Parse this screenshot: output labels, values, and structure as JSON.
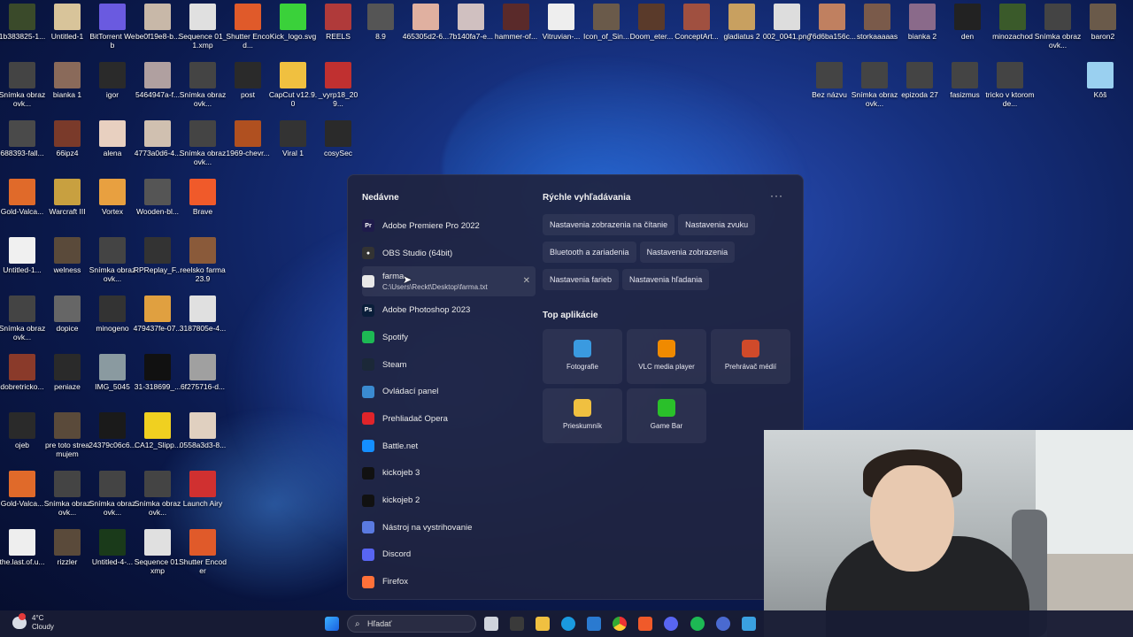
{
  "desktop": {
    "icons": [
      {
        "label": "1b383825-1...",
        "c": "#3a4a2a"
      },
      {
        "label": "Untitled-1",
        "c": "#d8c49a"
      },
      {
        "label": "BitTorrent Web",
        "c": "#6a5ae0"
      },
      {
        "label": "be0f19e8-b...",
        "c": "#c8b8a8"
      },
      {
        "label": "Sequence 01_1.xmp",
        "c": "#e0e0e0"
      },
      {
        "label": "Shutter Encod...",
        "c": "#e05a2a"
      },
      {
        "label": "Kick_logo.svg",
        "c": "#3ad13a"
      },
      {
        "label": "REELS",
        "c": "#b03a3a"
      },
      {
        "label": "Snímka obrazovk...",
        "c": "#444"
      },
      {
        "label": "bianka 1",
        "c": "#8a6a5a"
      },
      {
        "label": "igor",
        "c": "#2a2a2a"
      },
      {
        "label": "5464947a-f...",
        "c": "#b0a0a0"
      },
      {
        "label": "Snímka obrazovk...",
        "c": "#444"
      },
      {
        "label": "post",
        "c": "#2a2a2a"
      },
      {
        "label": "CapCut v12.9.0",
        "c": "#f0c040"
      },
      {
        "label": "_vyrp18_209...",
        "c": "#c03030"
      },
      {
        "label": "688393-fall...",
        "c": "#4a4a4a"
      },
      {
        "label": "66ipz4",
        "c": "#7a3a2a"
      },
      {
        "label": "alena",
        "c": "#e8d0c0"
      },
      {
        "label": "4773a0d6-4...",
        "c": "#d0c0b0"
      },
      {
        "label": "Snímka obrazovk...",
        "c": "#444"
      },
      {
        "label": "1969-chevr...",
        "c": "#b05020"
      },
      {
        "label": "Viral 1",
        "c": "#333"
      },
      {
        "label": "cosySec",
        "c": "#2a2a2a"
      },
      {
        "label": "Gold-Valca...",
        "c": "#e06a2a"
      },
      {
        "label": "Warcraft III",
        "c": "#c8a040"
      },
      {
        "label": "Vortex",
        "c": "#e8a040"
      },
      {
        "label": "Wooden-bl...",
        "c": "#555"
      },
      {
        "label": "Brave",
        "c": "#f05a2a"
      },
      {
        "label": "Untitled-1...",
        "c": "#f0f0f0"
      },
      {
        "label": "welness",
        "c": "#5a4a3a"
      },
      {
        "label": "Snímka obrazovk...",
        "c": "#444"
      },
      {
        "label": "RPReplay_F...",
        "c": "#333"
      },
      {
        "label": "reelsko farma 23.9",
        "c": "#8a5a3a"
      },
      {
        "label": "Snímka obrazovk...",
        "c": "#444"
      },
      {
        "label": "dopice",
        "c": "#666"
      },
      {
        "label": "minogeno",
        "c": "#333"
      },
      {
        "label": "479437fe-07...",
        "c": "#e0a040"
      },
      {
        "label": "3187805e-4...",
        "c": "#e0e0e0"
      },
      {
        "label": "dobretricko...",
        "c": "#8a3a2a"
      },
      {
        "label": "peniaze",
        "c": "#2a2a2a"
      },
      {
        "label": "IMG_5045",
        "c": "#8a9aa0"
      },
      {
        "label": "31-318699_...",
        "c": "#111"
      },
      {
        "label": "6f275716-d...",
        "c": "#a0a0a0"
      },
      {
        "label": "ojeb",
        "c": "#2a2a2a"
      },
      {
        "label": "pre toto streamujem",
        "c": "#5a4a3a"
      },
      {
        "label": "24379c06c6...",
        "c": "#1a1a1a"
      },
      {
        "label": "CA12_Slipp...",
        "c": "#f0d020"
      },
      {
        "label": "0558a3d3-8...",
        "c": "#e0d0c0"
      },
      {
        "label": "Gold-Valca...",
        "c": "#e06a2a"
      },
      {
        "label": "Snímka obrazovk...",
        "c": "#444"
      },
      {
        "label": "Snímka obrazovk...",
        "c": "#444"
      },
      {
        "label": "Snímka obrazovk...",
        "c": "#444"
      },
      {
        "label": "Launch Airy",
        "c": "#d03030"
      },
      {
        "label": "the.last.of.u...",
        "c": "#eee"
      },
      {
        "label": "rizzler",
        "c": "#5a4a3a"
      },
      {
        "label": "Untitled-4-...",
        "c": "#1a3a1a"
      },
      {
        "label": "Sequence 01.xmp",
        "c": "#e0e0e0"
      },
      {
        "label": "Shutter Encoder",
        "c": "#e05a2a"
      }
    ],
    "icons2": [
      {
        "label": "8.9",
        "c": "#555"
      },
      {
        "label": "465305d2-6...",
        "c": "#e0b0a0"
      },
      {
        "label": "7b140fa7-e...",
        "c": "#d0c0c0"
      },
      {
        "label": "hammer-of...",
        "c": "#5a2a2a"
      },
      {
        "label": "Vitruvian-...",
        "c": "#eee"
      },
      {
        "label": "Icon_of_Sin...",
        "c": "#6a5a4a"
      },
      {
        "label": "Doom_eter...",
        "c": "#5a3a2a"
      },
      {
        "label": "ConceptArt...",
        "c": "#a05040"
      },
      {
        "label": "gladiatus 2",
        "c": "#c8a060"
      },
      {
        "label": "002_0041.png",
        "c": "#ddd"
      },
      {
        "label": "76d6ba156c...",
        "c": "#c08060"
      },
      {
        "label": "storkaaaaas",
        "c": "#7a5a4a"
      },
      {
        "label": "bianka 2",
        "c": "#8a6a8a"
      },
      {
        "label": "den",
        "c": "#222"
      },
      {
        "label": "minozachod",
        "c": "#3a5a2a"
      },
      {
        "label": "Snímka obrazovk...",
        "c": "#444"
      },
      {
        "label": "baron2",
        "c": "#6a5a4a"
      }
    ],
    "right_labels": [
      "Bez názvu",
      "Snímka obrazovk...",
      "epizoda 27",
      "fasizmus",
      "tricko v ktorom de...",
      "Kôš"
    ]
  },
  "start_menu": {
    "recent_title": "Nedávne",
    "recent": [
      {
        "label": "Adobe Premiere Pro 2022",
        "icon": "premiere-icon",
        "c": "#1e1b4b",
        "t": "Pr"
      },
      {
        "label": "OBS Studio (64bit)",
        "icon": "obs-icon",
        "c": "#333",
        "t": "●"
      },
      {
        "label": "farma",
        "sub": "C:\\Users\\Reckt\\Desktop\\farma.txt",
        "icon": "text-file-icon",
        "c": "#e8e8e8",
        "t": ""
      },
      {
        "label": "Adobe Photoshop 2023",
        "icon": "photoshop-icon",
        "c": "#0a1e3a",
        "t": "Ps"
      },
      {
        "label": "Spotify",
        "icon": "spotify-icon",
        "c": "#1db954",
        "t": ""
      },
      {
        "label": "Steam",
        "icon": "steam-icon",
        "c": "#1b2838",
        "t": ""
      },
      {
        "label": "Ovládací panel",
        "icon": "control-panel-icon",
        "c": "#3a8ad0",
        "t": ""
      },
      {
        "label": "Prehliadač Opera",
        "icon": "opera-icon",
        "c": "#e0242a",
        "t": ""
      },
      {
        "label": "Battle.net",
        "icon": "battlenet-icon",
        "c": "#148eff",
        "t": ""
      },
      {
        "label": "kickojeb 3",
        "icon": "video-icon",
        "c": "#111",
        "t": ""
      },
      {
        "label": "kickojeb 2",
        "icon": "video-icon",
        "c": "#111",
        "t": ""
      },
      {
        "label": "Nástroj na vystrihovanie",
        "icon": "snipping-tool-icon",
        "c": "#5a7ae0",
        "t": ""
      },
      {
        "label": "Discord",
        "icon": "discord-icon",
        "c": "#5865f2",
        "t": ""
      },
      {
        "label": "Firefox",
        "icon": "firefox-icon",
        "c": "#ff7139",
        "t": ""
      }
    ],
    "quick_title": "Rýchle vyhľadávania",
    "more_label": "···",
    "quick": [
      "Nastavenia zobrazenia na čítanie",
      "Nastavenia zvuku",
      "Bluetooth a zariadenia",
      "Nastavenia zobrazenia",
      "Nastavenia farieb",
      "Nastavenia hľadania"
    ],
    "top_apps_title": "Top aplikácie",
    "top_apps": [
      {
        "label": "Fotografie",
        "icon": "photos-icon",
        "c": "#3a9ae0"
      },
      {
        "label": "VLC media player",
        "icon": "vlc-icon",
        "c": "#f08a00"
      },
      {
        "label": "Prehrávač médií",
        "icon": "media-player-icon",
        "c": "#d04a2a"
      },
      {
        "label": "Prieskumník",
        "icon": "file-explorer-icon",
        "c": "#f0c040"
      },
      {
        "label": "Game Bar",
        "icon": "game-bar-icon",
        "c": "#2ac02a"
      }
    ]
  },
  "taskbar": {
    "temperature": "4°C",
    "condition": "Cloudy",
    "search_placeholder": "Hľadať"
  }
}
